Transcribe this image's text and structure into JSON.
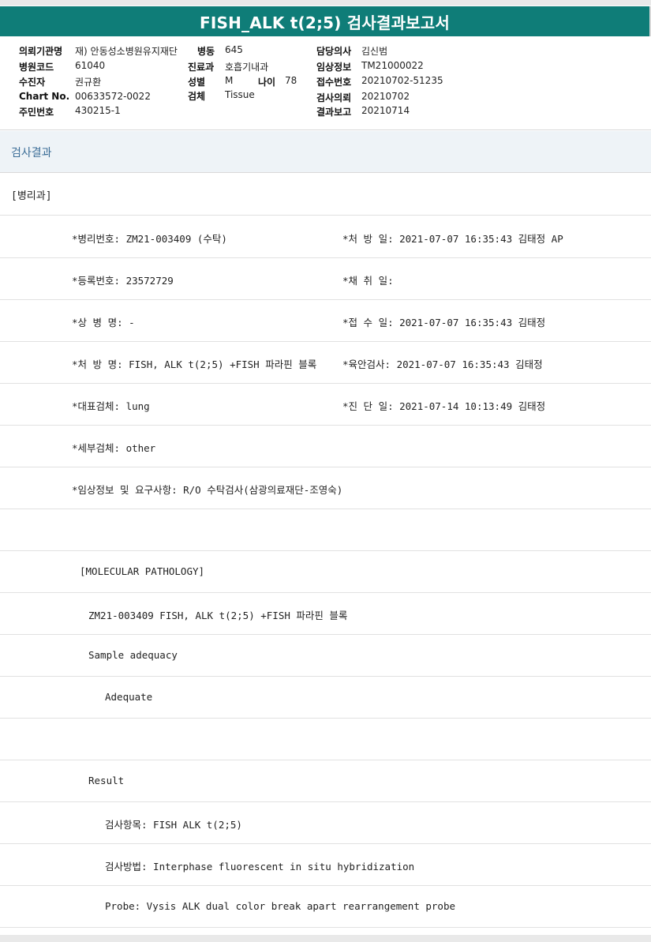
{
  "title": "FISH_ALK t(2;5) 검사결과보고서",
  "patient_info": {
    "institution_label": "의뢰기관명",
    "institution_value": "재) 안동성소병원유지재단",
    "ward_label": "병동",
    "ward_value": "645",
    "doctor_label": "담당의사",
    "doctor_value": "김신범",
    "hospital_code_label": "병원코드",
    "hospital_code_value": "61040",
    "department_label": "진료과",
    "department_value": "호흡기내과",
    "clinical_info_label": "임상정보",
    "clinical_info_value": "TM21000022",
    "recipient_label": "수진자",
    "recipient_value": "권규환",
    "sex_label": "성별",
    "sex_value": "M",
    "age_label": "나이",
    "age_value": "78",
    "receipt_no_label": "접수번호",
    "receipt_no_value": "20210702-51235",
    "chart_no_label": "Chart No.",
    "chart_no_value": "00633572-0022",
    "specimen_label": "검체",
    "specimen_value": "Tissue",
    "request_label": "검사의뢰",
    "request_value": "20210702",
    "resident_no_label": "주민번호",
    "resident_no_value": "430215-1",
    "report_label": "결과보고",
    "report_value": "20210714"
  },
  "section": {
    "title": "검사결과",
    "department": "[병리과]"
  },
  "report_rows": [
    {
      "left": "*병리번호: ZM21-003409 (수탁)",
      "right": "*처 방 일: 2021-07-07 16:35:43  김태정 AP"
    },
    {
      "left": "*등록번호: 23572729",
      "right": "*채 취 일:"
    },
    {
      "left": "*상 병 명: -",
      "right": "*접 수 일: 2021-07-07 16:35:43  김태정"
    },
    {
      "left": "*처 방 명: FISH, ALK t(2;5) +FISH 파라핀 블록",
      "right": "*육안검사: 2021-07-07 16:35:43  김태정"
    },
    {
      "left": "*대표검체: lung",
      "right": "*진 단 일: 2021-07-14 10:13:49  김태정"
    },
    {
      "left": "*세부검체: other",
      "right": ""
    },
    {
      "left": "*임상정보 및 요구사항: R/O 수탁검사(삼광의료재단-조영숙)",
      "right": ""
    },
    {
      "left": "",
      "right": ""
    }
  ],
  "molecular_rows": [
    {
      "text": "[MOLECULAR PATHOLOGY]",
      "indent": 0
    },
    {
      "text": "ZM21-003409     FISH, ALK t(2;5) +FISH 파라핀 블록",
      "indent": 1
    },
    {
      "text": "Sample adequacy",
      "indent": 1
    },
    {
      "text": "Adequate",
      "indent": 2
    },
    {
      "text": "",
      "indent": 0
    },
    {
      "text": "Result",
      "indent": 1
    },
    {
      "text": "검사항목: FISH ALK t(2;5)",
      "indent": 2
    },
    {
      "text": "검사방법: Interphase fluorescent in situ hybridization",
      "indent": 2
    },
    {
      "text": "Probe: Vysis ALK dual color break apart rearrangement probe",
      "indent": 2
    }
  ]
}
